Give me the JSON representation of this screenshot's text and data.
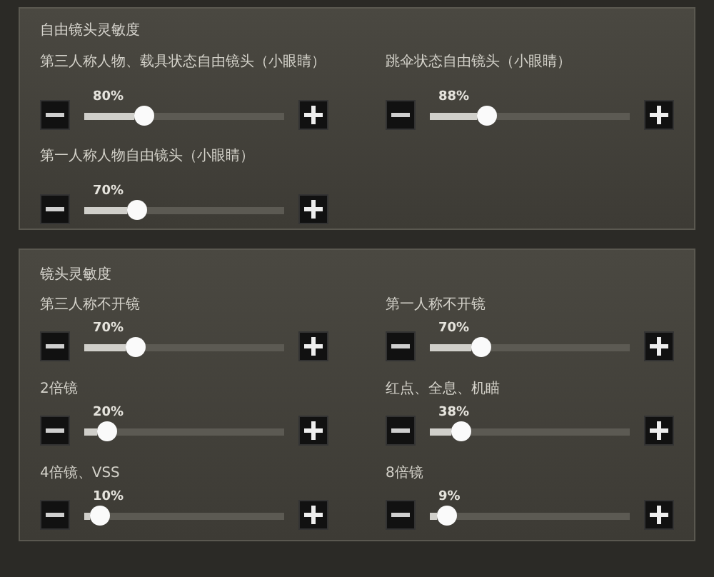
{
  "sections": [
    {
      "title": "自由镜头灵敏度",
      "settings": [
        {
          "label": "第三人称人物、载具状态自由镜头（小眼睛）",
          "value": "80%",
          "level": 0.28
        },
        {
          "label": "跳伞状态自由镜头（小眼睛）",
          "value": "88%",
          "level": 0.26
        },
        {
          "label": "第一人称人物自由镜头（小眼睛）",
          "value": "70%",
          "level": 0.24
        }
      ]
    },
    {
      "title": "镜头灵敏度",
      "settings": [
        {
          "label": "第三人称不开镜",
          "value": "70%",
          "level": 0.23
        },
        {
          "label": "第一人称不开镜",
          "value": "70%",
          "level": 0.23
        },
        {
          "label": "2倍镜",
          "value": "20%",
          "level": 0.07
        },
        {
          "label": "红点、全息、机瞄",
          "value": "38%",
          "level": 0.12
        },
        {
          "label": "4倍镜、VSS",
          "value": "10%",
          "level": 0.03
        },
        {
          "label": "8倍镜",
          "value": "9%",
          "level": 0.04
        }
      ]
    }
  ]
}
